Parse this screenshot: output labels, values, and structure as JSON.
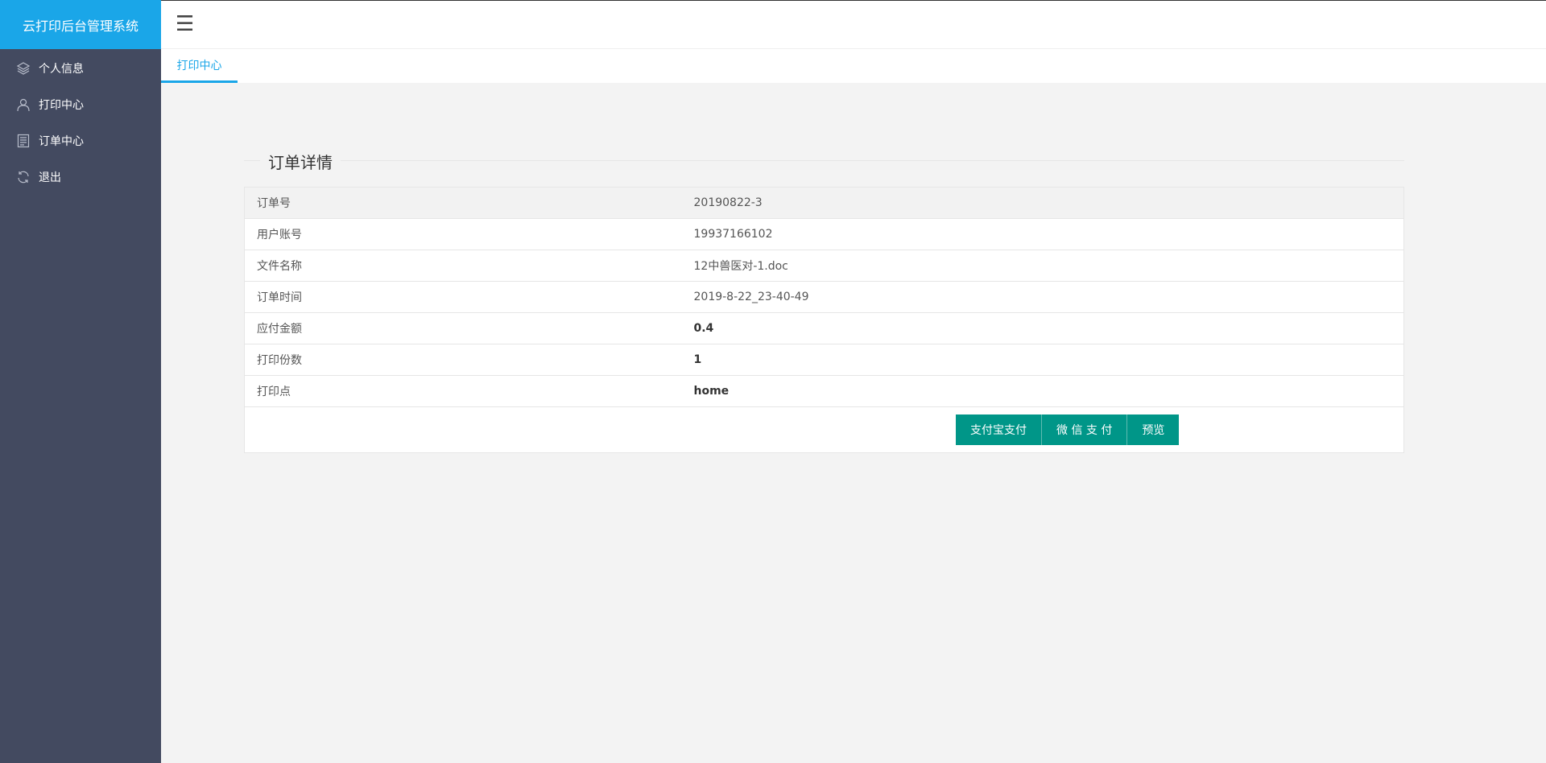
{
  "app": {
    "title": "云打印后台管理系统"
  },
  "sidebar": {
    "items": [
      {
        "label": "个人信息",
        "icon": "layers-icon"
      },
      {
        "label": "打印中心",
        "icon": "user-icon"
      },
      {
        "label": "订单中心",
        "icon": "list-icon"
      },
      {
        "label": "退出",
        "icon": "refresh-icon"
      }
    ]
  },
  "header": {
    "menu_icon": "☰"
  },
  "tabs": [
    {
      "label": "打印中心"
    }
  ],
  "order": {
    "section_title": "订单详情",
    "rows": [
      {
        "key": "订单号",
        "value": "20190822-3"
      },
      {
        "key": "用户账号",
        "value": "19937166102"
      },
      {
        "key": "文件名称",
        "value": "12中兽医对-1.doc"
      },
      {
        "key": "订单时间",
        "value": "2019-8-22_23-40-49"
      },
      {
        "key": "应付金额",
        "value": "0.4"
      },
      {
        "key": "打印份数",
        "value": "1"
      },
      {
        "key": "打印点",
        "value": "home"
      }
    ],
    "buttons": {
      "alipay": "支付宝支付",
      "wechat": "微 信 支 付",
      "preview": "预览"
    }
  },
  "colors": {
    "accent": "#1aa6e8",
    "sidebar_bg": "#434a60",
    "button": "#009688"
  }
}
